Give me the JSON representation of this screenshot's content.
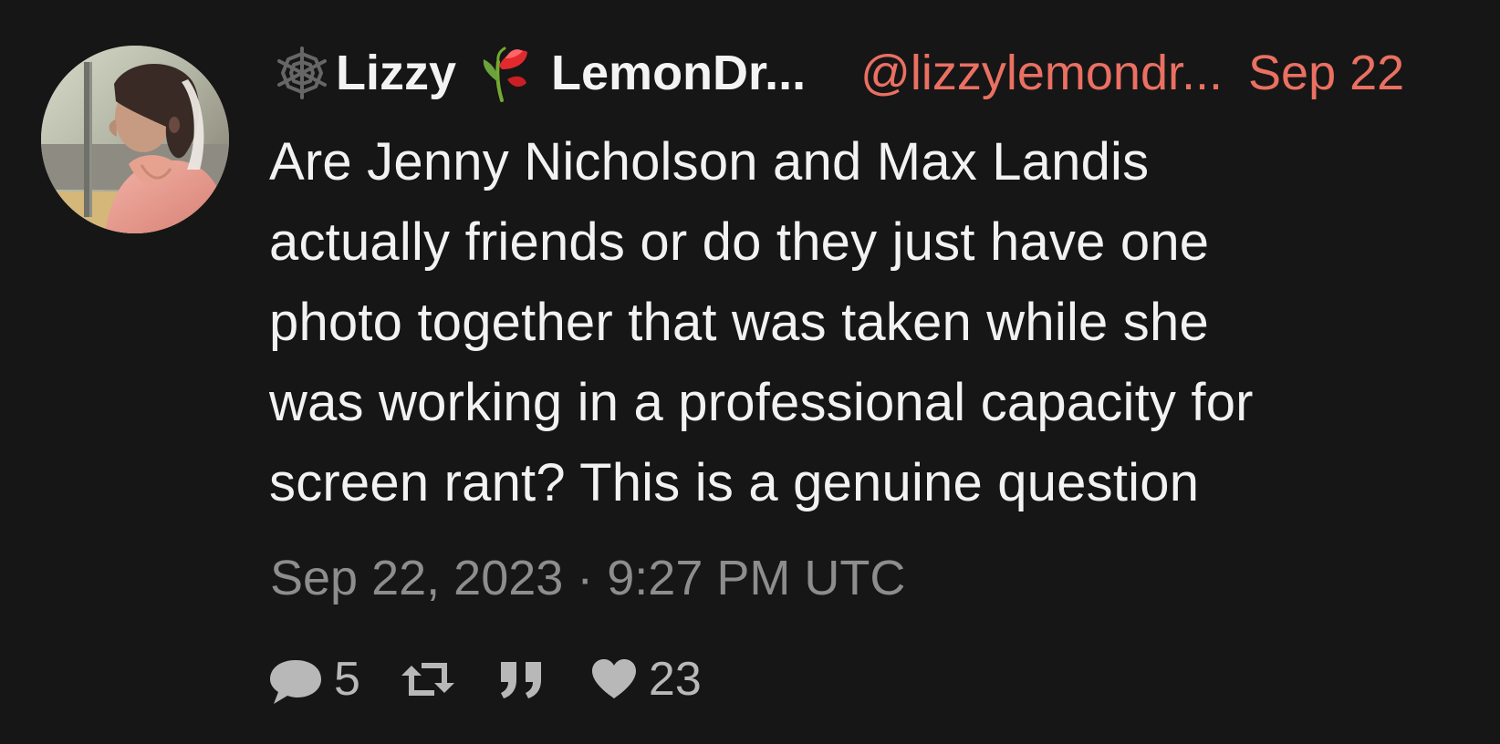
{
  "post": {
    "display_name_first": "Lizzy",
    "display_name_second": "LemonDr...",
    "username": "@lizzylemondr...",
    "date_short": "Sep 22",
    "content_lines": [
      "Are Jenny Nicholson and Max Landis",
      "actually friends or do they just have one",
      "photo together that was taken while she",
      "was working in a professional capacity for",
      "screen rant? This is a genuine question"
    ],
    "timestamp": "Sep 22, 2023 · 9:27 PM UTC",
    "stats": {
      "comments": "5",
      "likes": "23"
    }
  },
  "icons": {
    "name_emoji_1": "spider-web-icon",
    "name_emoji_2": "wilted-rose-icon",
    "comment": "comment-icon",
    "retweet": "retweet-icon",
    "quote": "quote-icon",
    "like": "heart-icon"
  },
  "colors": {
    "background": "#161616",
    "accent": "#ea7062",
    "text": "#eeeeee",
    "muted": "#8d8d8d"
  }
}
